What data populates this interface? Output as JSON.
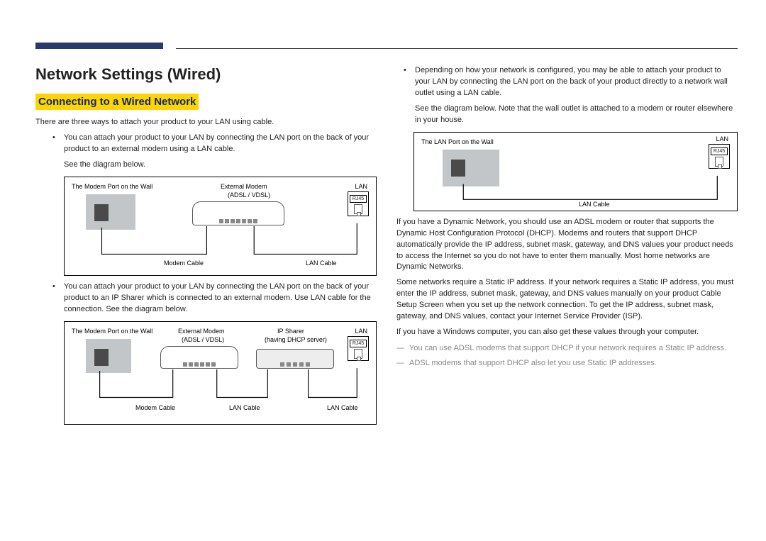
{
  "page": {
    "title": "Network Settings (Wired)",
    "subtitle": "Connecting to a Wired Network"
  },
  "left": {
    "intro": "There are three ways to attach your product to your LAN using cable.",
    "bullet1": "You can attach your product to your LAN by connecting the LAN port on the back of your product to an external modem using a LAN cable.",
    "bullet1_sub": "See the diagram below.",
    "bullet2": "You can attach your product to your LAN by connecting the LAN port on the back of your product to an IP Sharer which is connected to an external modem. Use LAN cable for the connection. See the diagram below."
  },
  "right": {
    "bullet3": "Depending on how your network is configured, you may be able to attach your product to your LAN by connecting the LAN port on the back of your product directly to a network wall outlet using a LAN cable.",
    "bullet3_sub": "See the diagram below. Note that the wall outlet is attached to a modem or router elsewhere in your house.",
    "para1": "If you have a Dynamic Network, you should use an ADSL modem or router that supports the Dynamic Host Configuration Protocol (DHCP). Modems and routers that support DHCP automatically provide the IP address, subnet mask, gateway, and DNS values your product needs to access the Internet so you do not have to enter them manually. Most home networks are Dynamic Networks.",
    "para2": "Some networks require a Static IP address. If your network requires a Static IP address, you must enter the IP address, subnet mask, gateway, and DNS values manually on your product Cable Setup Screen when you set up the network connection. To get the IP address, subnet mask, gateway, and DNS values, contact your Internet Service Provider (ISP).",
    "para3": "If you have a Windows computer, you can also get these values through your computer.",
    "note1": "You can use ADSL modems that support DHCP if your network requires a Static IP address.",
    "note2": "ADSL modems that support DHCP also let you use Static IP addresses."
  },
  "diagram": {
    "wall_modem": "The Modem Port on the Wall",
    "wall_lan": "The LAN Port on the Wall",
    "ext_modem": "External Modem",
    "ext_modem_sub": "(ADSL / VDSL)",
    "ip_sharer": "IP Sharer",
    "ip_sharer_sub": "(having DHCP server)",
    "modem_cable": "Modem Cable",
    "lan_cable": "LAN Cable",
    "lan": "LAN",
    "rj45": "RJ45"
  }
}
